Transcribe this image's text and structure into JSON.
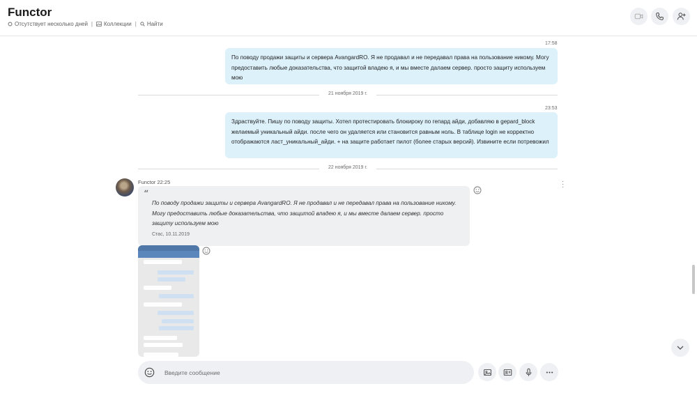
{
  "header": {
    "title": "Functor",
    "status": "Отсутствует несколько дней",
    "collections": "Коллекции",
    "find": "Найти",
    "icons": [
      "video-call-icon",
      "audio-call-icon",
      "add-people-icon"
    ]
  },
  "messages": {
    "m1": {
      "time": "17:58",
      "text": "По поводу продажи защиты и сервера AvangardRO. Я не продавал и не передавал права на пользование никому. Могу предоставить любые доказательства, что защитой владею я, и мы вместе далаем сервер. просто защиту используем мою"
    },
    "divider1": "21 ноября 2019 г.",
    "m2": {
      "time": "23:53",
      "text": "Здраствуйте. Пишу по поводу защиты. Хотел протестировать блокироку по гепард айди, добавляю в gepard_block желаемый уникальный айди. после чего он удаляется или становится равным ноль. В  таблице login не корректно отображаются ласт_уникальный_айди. + на защите работает пилот (более старых версий). Извините если потревожил"
    },
    "divider2": "22 ноября 2019 г.",
    "m3": {
      "sender": "Functor",
      "time": "22:25",
      "sender_line": "Functor 22:25",
      "quote": "По поводу продажи защиты и сервера AvangardRO. Я не продавал и не передавал права на пользование никому. Могу предоставить любые доказательства, что защитой владею я, и мы вместе далаем сервер. просто защиту используем мою",
      "quote_meta": "Стас, 10.11.2019"
    }
  },
  "composer": {
    "placeholder": "Введите сообщение"
  },
  "colors": {
    "outgoing_bubble": "#ddf1fb",
    "incoming_bubble": "#eef0f2",
    "button_bg": "#eef0f3"
  }
}
